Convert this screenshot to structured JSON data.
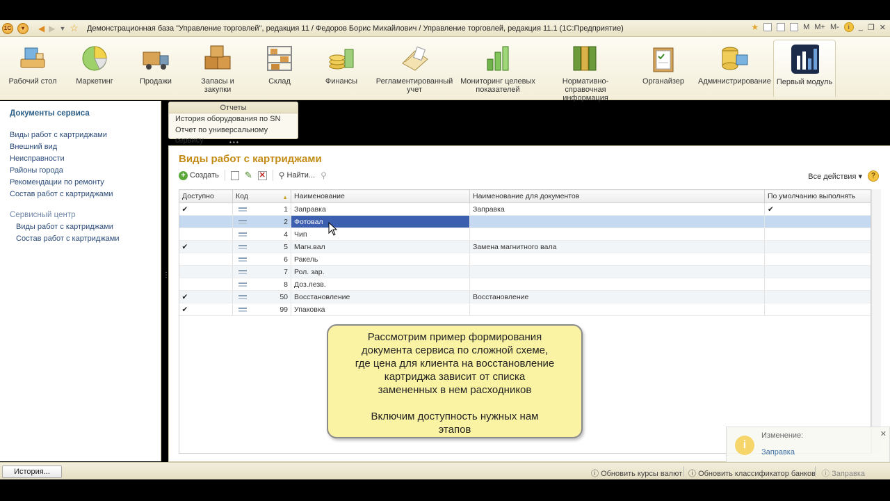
{
  "window": {
    "title": "Демонстрационная база \"Управление торговлей\", редакция 11 / Федоров Борис Михайлович / Управление торговлей, редакция 11.1  (1С:Предприятие)",
    "right_buttons": [
      "M",
      "M+",
      "M-"
    ]
  },
  "sections": [
    {
      "label": "Рабочий стол",
      "icon": "desk-icon"
    },
    {
      "label": "Маркетинг",
      "icon": "pie-chart-icon"
    },
    {
      "label": "Продажи",
      "icon": "truck-icon"
    },
    {
      "label": "Запасы и закупки",
      "icon": "boxes-icon"
    },
    {
      "label": "Склад",
      "icon": "warehouse-icon"
    },
    {
      "label": "Финансы",
      "icon": "coins-icon"
    },
    {
      "label": "Регламентированный учет",
      "icon": "documents-icon"
    },
    {
      "label": "Мониторинг целевых показателей",
      "icon": "bar-chart-icon"
    },
    {
      "label": "Нормативно-справочная информация",
      "icon": "binders-icon"
    },
    {
      "label": "Органайзер",
      "icon": "clipboard-icon"
    },
    {
      "label": "Администрирование",
      "icon": "server-icon"
    },
    {
      "label": "Первый модуль",
      "icon": "module-icon"
    }
  ],
  "left_nav": {
    "header": "Документы сервиса",
    "items": [
      "Виды работ с картриджами",
      "Внешний вид",
      "Неисправности",
      "Районы города",
      "Рекомендации по ремонту",
      "Состав работ с картриджами"
    ],
    "group": "Сервисный центр",
    "group_items": [
      "Виды работ с картриджами",
      "Состав работ с картриджами"
    ]
  },
  "reports": {
    "title": "Отчеты",
    "items": [
      "История оборудования по SN",
      "Отчет по универсальному сервису"
    ]
  },
  "main": {
    "title": "Виды работ с картриджами",
    "toolbar": {
      "create": "Создать",
      "find": "Найти...",
      "all_actions": "Все действия"
    }
  },
  "table": {
    "columns": [
      "Доступно",
      "Код",
      "Наименование",
      "Наименование для документов",
      "По умолчанию выполнять"
    ],
    "rows": [
      {
        "available": "✔",
        "code": "1",
        "name": "Заправка",
        "doc_name": "Заправка",
        "default": "✔"
      },
      {
        "available": "",
        "code": "2",
        "name": "Фотовал",
        "doc_name": "",
        "default": ""
      },
      {
        "available": "",
        "code": "4",
        "name": "Чип",
        "doc_name": "",
        "default": ""
      },
      {
        "available": "✔",
        "code": "5",
        "name": "Магн.вал",
        "doc_name": "Замена магнитного вала",
        "default": ""
      },
      {
        "available": "",
        "code": "6",
        "name": "Ракель",
        "doc_name": "",
        "default": ""
      },
      {
        "available": "",
        "code": "7",
        "name": "Рол. зар.",
        "doc_name": "",
        "default": ""
      },
      {
        "available": "",
        "code": "8",
        "name": "Доз.лезв.",
        "doc_name": "",
        "default": ""
      },
      {
        "available": "✔",
        "code": "50",
        "name": "Восстановление",
        "doc_name": "Восстановление",
        "default": ""
      },
      {
        "available": "✔",
        "code": "99",
        "name": "Упаковка",
        "doc_name": "",
        "default": ""
      }
    ]
  },
  "callout": {
    "lines": [
      "Рассмотрим пример формирования",
      "документа сервиса по сложной схеме,",
      "где цена для клиента на восстановление",
      "картриджа зависит от списка",
      "замененных в нем расходников"
    ],
    "lines2": [
      "Включим доступность нужных нам",
      "этапов"
    ]
  },
  "notification": {
    "title": "Изменение:",
    "link": "Заправка"
  },
  "statusbar": {
    "history": "История...",
    "rates": "Обновить курсы валют",
    "banks": "Обновить классификатор банков",
    "fill": "Заправка"
  }
}
